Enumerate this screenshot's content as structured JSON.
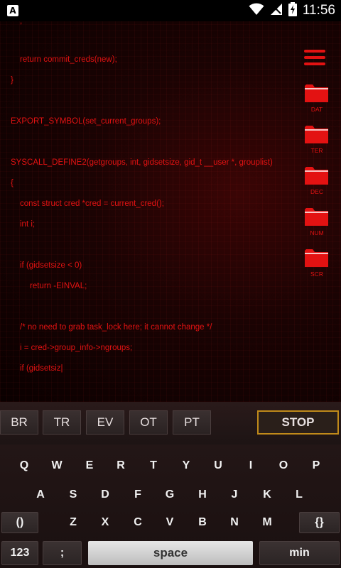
{
  "status_bar": {
    "app_icon": "A",
    "time": "11:56",
    "icons": [
      "wifi-icon",
      "no-signal-icon",
      "battery-charging-icon"
    ]
  },
  "code": {
    "lines": [
      ";",
      "return commit_creds(new);",
      "}",
      "EXPORT_SYMBOL(set_current_groups);",
      "SYSCALL_DEFINE2(getgroups, int, gidsetsize, gid_t __user *, grouplist)",
      "{",
      "const struct cred *cred = current_cred();",
      "int i;",
      "if (gidsetsize < 0)",
      "return -EINVAL;",
      "/* no need to grab task_lock here; it cannot change */",
      "i = cred->group_info->ngroups;",
      "if (gidsetsiz|"
    ]
  },
  "side_menu": {
    "folders": [
      {
        "label": "DAT"
      },
      {
        "label": "TER"
      },
      {
        "label": "DEC"
      },
      {
        "label": "NUM"
      },
      {
        "label": "SCR"
      }
    ]
  },
  "command_bar": {
    "buttons": [
      "BR",
      "TR",
      "EV",
      "OT",
      "PT"
    ],
    "stop_label": "STOP"
  },
  "keyboard": {
    "row1": [
      "Q",
      "W",
      "E",
      "R",
      "T",
      "Y",
      "U",
      "I",
      "O",
      "P"
    ],
    "row2": [
      "A",
      "S",
      "D",
      "F",
      "G",
      "H",
      "J",
      "K",
      "L"
    ],
    "row3_left": "()",
    "row3": [
      "Z",
      "X",
      "C",
      "V",
      "B",
      "N",
      "M"
    ],
    "row3_right": "{}",
    "num_key": "123",
    "semicolon_key": ";",
    "space_key": "space",
    "min_key": "min"
  },
  "colors": {
    "code_text": "#e31212",
    "stop_border": "#c08a1a"
  }
}
